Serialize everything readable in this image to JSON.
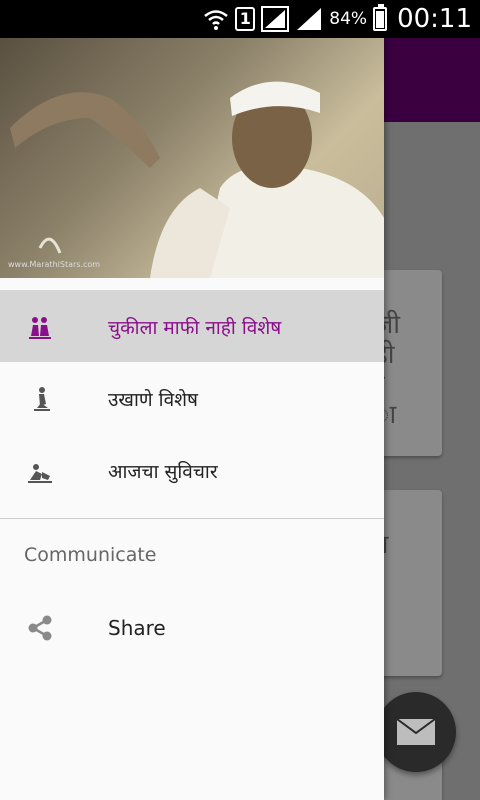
{
  "status_bar": {
    "sim_slot": "1",
    "battery_percent": "84%",
    "battery_level": 0.84,
    "time": "00:11",
    "icons": [
      "wifi-icon",
      "sim-icon",
      "signal-icon",
      "signal-icon",
      "battery-icon"
    ]
  },
  "drawer": {
    "header_watermark": "www.MarathiStars.com",
    "menu_items": [
      {
        "label": "चुकीला माफी नाही  विशेष",
        "icon": "couple-icon",
        "selected": true
      },
      {
        "label": "उखाणे विशेष",
        "icon": "kneeling-figure-icon",
        "selected": false
      },
      {
        "label": "आजचा सुविचार",
        "icon": "reading-figure-icon",
        "selected": false
      }
    ],
    "section_header": "Communicate",
    "share_label": "Share"
  },
  "background": {
    "card1_text": "जी\nही\nर\nा",
    "card2_text": "न",
    "colors": {
      "toolbar": "#3a0040",
      "accent": "#8a0f8a"
    }
  }
}
